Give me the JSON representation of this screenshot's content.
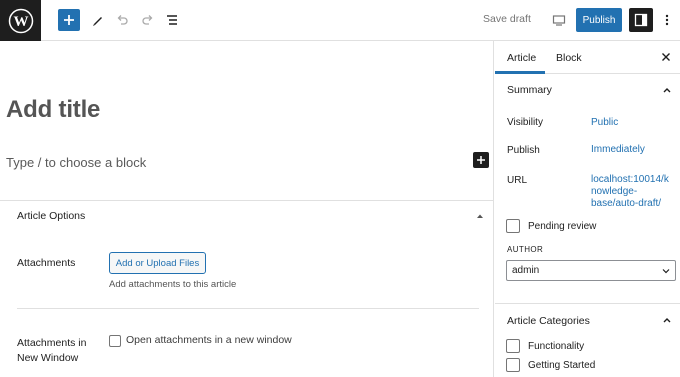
{
  "toolbar": {
    "logo_icon": "wordpress-logo",
    "add_icon": "plus-icon",
    "tools_icon": "pencil-icon",
    "undo_icon": "undo-icon",
    "redo_icon": "redo-icon",
    "list_view_icon": "list-view-icon",
    "save_draft_label": "Save draft",
    "preview_icon": "desktop-preview-icon",
    "publish_label": "Publish",
    "settings_icon": "sidebar-settings-icon",
    "options_icon": "more-vertical-icon",
    "accent_color": "#2271b1"
  },
  "editor": {
    "title_placeholder": "Add title",
    "block_prompt": "Type / to choose a block",
    "meta_box": {
      "title": "Article Options",
      "attachments_label": "Attachments",
      "upload_button_label": "Add or Upload Files",
      "attachments_help": "Add attachments to this article",
      "new_window_label_line1": "Attachments in",
      "new_window_label_line2": "New Window",
      "new_window_checkbox_label": "Open attachments in a new window",
      "new_window_checked": false
    }
  },
  "sidebar": {
    "tabs": [
      {
        "label": "Article",
        "active": true
      },
      {
        "label": "Block",
        "active": false
      }
    ],
    "summary": {
      "title": "Summary",
      "visibility_label": "Visibility",
      "visibility_value": "Public",
      "publish_label": "Publish",
      "publish_value": "Immediately",
      "url_label": "URL",
      "url_value_line1": "localhost:10014/k",
      "url_value_line2": "nowledge-",
      "url_value_line3": "base/auto-draft/",
      "pending_review_label": "Pending review",
      "pending_review_checked": false,
      "author_label": "AUTHOR",
      "author_value": "admin"
    },
    "categories": {
      "title": "Article Categories",
      "items": [
        {
          "label": "Functionality",
          "checked": false
        },
        {
          "label": "Getting Started",
          "checked": false
        }
      ]
    }
  }
}
